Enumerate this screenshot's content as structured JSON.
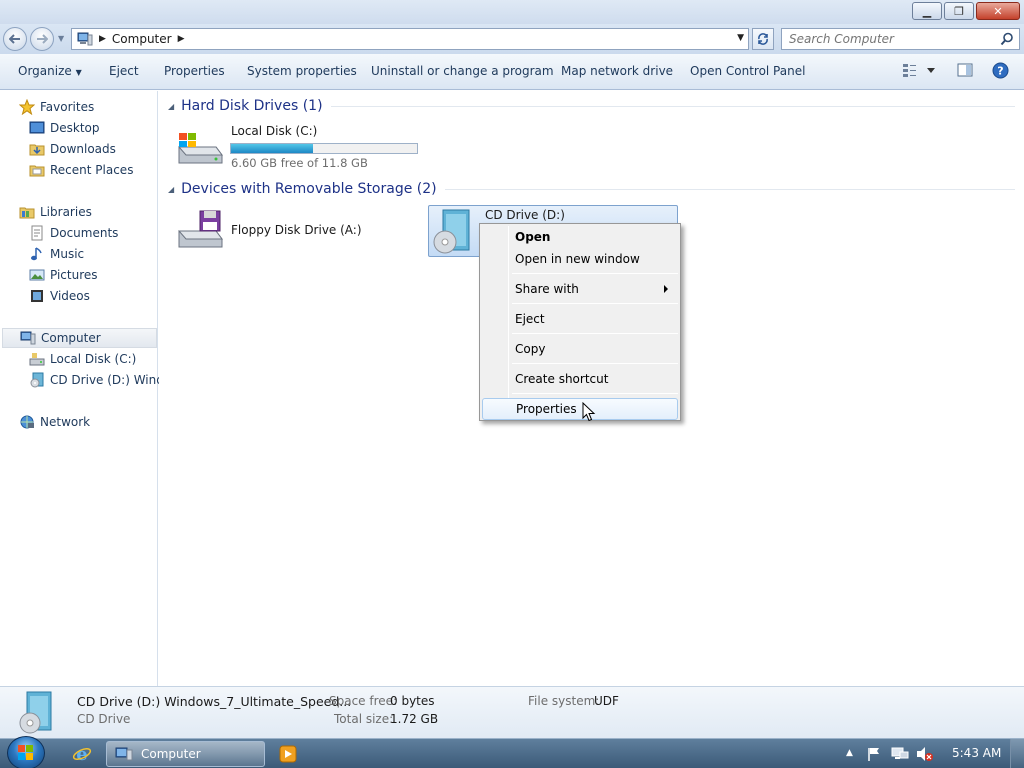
{
  "window": {
    "minimize_glyph": "▁",
    "restore_glyph": "❐",
    "close_glyph": "✕"
  },
  "address": {
    "crumbs": [
      "Computer"
    ],
    "search_placeholder": "Search Computer"
  },
  "toolbar": {
    "organize": "Organize",
    "eject": "Eject",
    "properties": "Properties",
    "system_properties": "System properties",
    "uninstall": "Uninstall or change a program",
    "map_drive": "Map network drive",
    "control_panel": "Open Control Panel"
  },
  "nav": {
    "favorites": "Favorites",
    "desktop": "Desktop",
    "downloads": "Downloads",
    "recent_places": "Recent Places",
    "libraries": "Libraries",
    "documents": "Documents",
    "music": "Music",
    "pictures": "Pictures",
    "videos": "Videos",
    "computer": "Computer",
    "local_disk": "Local Disk (C:)",
    "cd_drive": "CD Drive (D:) Windo",
    "network": "Network"
  },
  "content": {
    "hdd_group": "Hard Disk Drives (1)",
    "removable_group": "Devices with Removable Storage (2)",
    "local_disk": {
      "name": "Local Disk (C:)",
      "free": "6.60 GB free of 11.8 GB",
      "used_fraction": 0.44
    },
    "floppy": {
      "name": "Floppy Disk Drive (A:)"
    },
    "cd": {
      "name": "CD Drive (D:)"
    }
  },
  "context_menu": {
    "items": [
      "Open",
      "Open in new window",
      "Share with",
      "Eject",
      "Copy",
      "Create shortcut",
      "Properties"
    ]
  },
  "details": {
    "title": "CD Drive (D:) Windows_7_Ultimate_Speed...",
    "type": "CD Drive",
    "space_free_label": "Space free:",
    "space_free_value": "0 bytes",
    "total_size_label": "Total size:",
    "total_size_value": "1.72 GB",
    "fs_label": "File system:",
    "fs_value": "UDF"
  },
  "taskbar": {
    "task_label": "Computer",
    "clock": "5:43 AM"
  },
  "colors": {
    "accent": "#1e3287",
    "capacity_fill": "#1d87c5",
    "selection": "#c4dbf5"
  }
}
